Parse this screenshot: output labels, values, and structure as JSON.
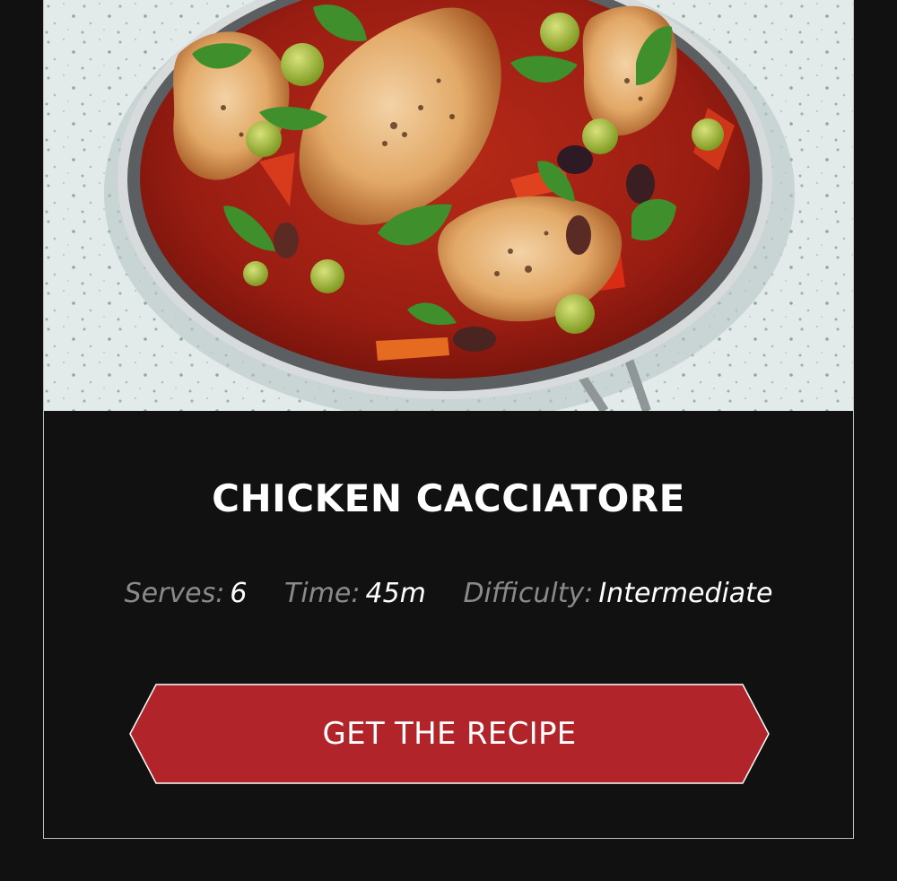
{
  "recipe": {
    "title": "CHICKEN CACCIATORE",
    "serves_label": "Serves:",
    "serves_value": "6",
    "time_label": "Time:",
    "time_value": "45m",
    "difficulty_label": "Difficulty:",
    "difficulty_value": "Intermediate"
  },
  "cta": {
    "label": "GET THE RECIPE"
  },
  "colors": {
    "background": "#111111",
    "accent": "#b0242a",
    "label_gray": "#8a8a8a",
    "text": "#ffffff"
  }
}
